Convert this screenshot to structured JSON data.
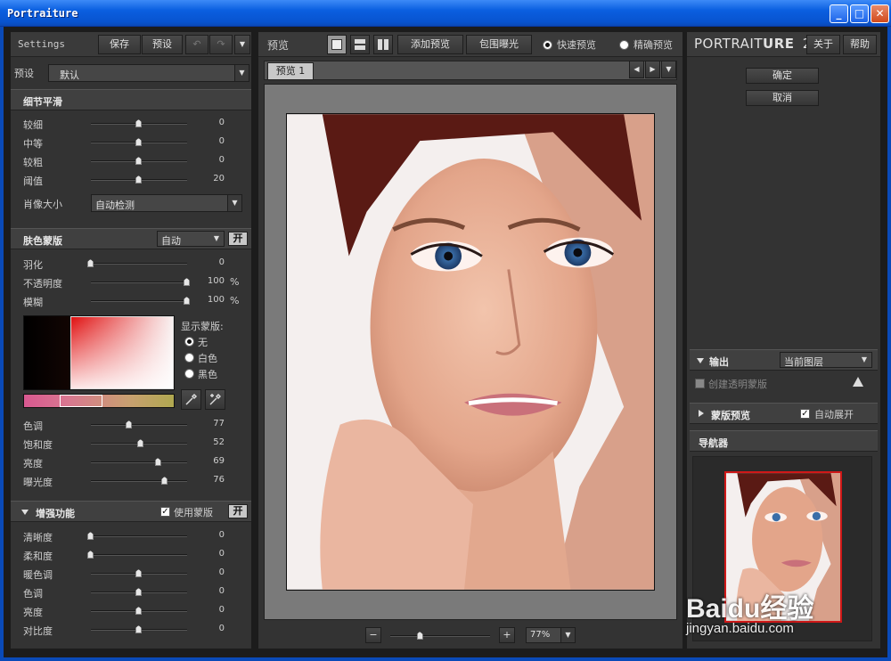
{
  "window": {
    "title": "Portraiture",
    "minimize": "_",
    "maximize": "□",
    "close": "✕"
  },
  "left": {
    "settings_label": "Settings",
    "save": "保存",
    "preset_btn": "预设",
    "preset_label": "预设",
    "preset_value": "默认",
    "detail": {
      "title": "细节平滑",
      "sliders": [
        {
          "label": "较细",
          "value": 0,
          "pos": 0.5
        },
        {
          "label": "中等",
          "value": 0,
          "pos": 0.5
        },
        {
          "label": "较粗",
          "value": 0,
          "pos": 0.5
        },
        {
          "label": "阈值",
          "value": 20,
          "pos": 0.5
        }
      ],
      "size_label": "肖像大小",
      "size_value": "自动检测"
    },
    "skin": {
      "title": "肤色蒙版",
      "mode": "自动",
      "toggle": "开",
      "sliders": [
        {
          "label": "羽化",
          "value": "0",
          "unit": "",
          "pos": 0.0
        },
        {
          "label": "不透明度",
          "value": "100",
          "unit": "%",
          "pos": 1.0
        },
        {
          "label": "模糊",
          "value": "100",
          "unit": "%",
          "pos": 1.0
        }
      ],
      "show_mask_label": "显示蒙版:",
      "mask_options": [
        "无",
        "白色",
        "黑色"
      ],
      "mask_selected": 0,
      "color_sliders": [
        {
          "label": "色调",
          "value": 77,
          "pos": 0.4
        },
        {
          "label": "饱和度",
          "value": 52,
          "pos": 0.52
        },
        {
          "label": "亮度",
          "value": 69,
          "pos": 0.7
        },
        {
          "label": "曝光度",
          "value": 76,
          "pos": 0.77
        }
      ]
    },
    "enhance": {
      "title": "增强功能",
      "use_mask": "使用蒙版",
      "toggle": "开",
      "sliders": [
        {
          "label": "清晰度",
          "value": 0,
          "pos": 0.0
        },
        {
          "label": "柔和度",
          "value": 0,
          "pos": 0.0
        },
        {
          "label": "暖色调",
          "value": 0,
          "pos": 0.5
        },
        {
          "label": "色调",
          "value": 0,
          "pos": 0.5
        },
        {
          "label": "亮度",
          "value": 0,
          "pos": 0.5
        },
        {
          "label": "对比度",
          "value": 0,
          "pos": 0.5
        }
      ]
    }
  },
  "center": {
    "preview_label": "预览",
    "add_preview": "添加预览",
    "bracket": "包围曝光",
    "fast_preview": "快速预览",
    "precise_preview": "精确预览",
    "tab": "预览 1",
    "zoom_minus": "−",
    "zoom_plus": "+",
    "zoom_pos": 0.3,
    "zoom_value": "77%"
  },
  "right": {
    "brand_main": "PORTRAIT",
    "brand_bold": "URE",
    "brand_ver": "2",
    "about": "关于",
    "help": "帮助",
    "ok": "确定",
    "cancel": "取消",
    "output_title": "输出",
    "output_value": "当前图层",
    "transparent_mask": "创建透明蒙版",
    "mask_preview": "蒙版预览",
    "auto_expand": "自动展开",
    "navigator": "导航器"
  },
  "watermark": {
    "logo": "Baidu经验",
    "url": "jingyan.baidu.com"
  },
  "colors": {
    "accent_title": "#0a5fe0",
    "panel": "#333333",
    "nav_frame": "#d01818"
  }
}
